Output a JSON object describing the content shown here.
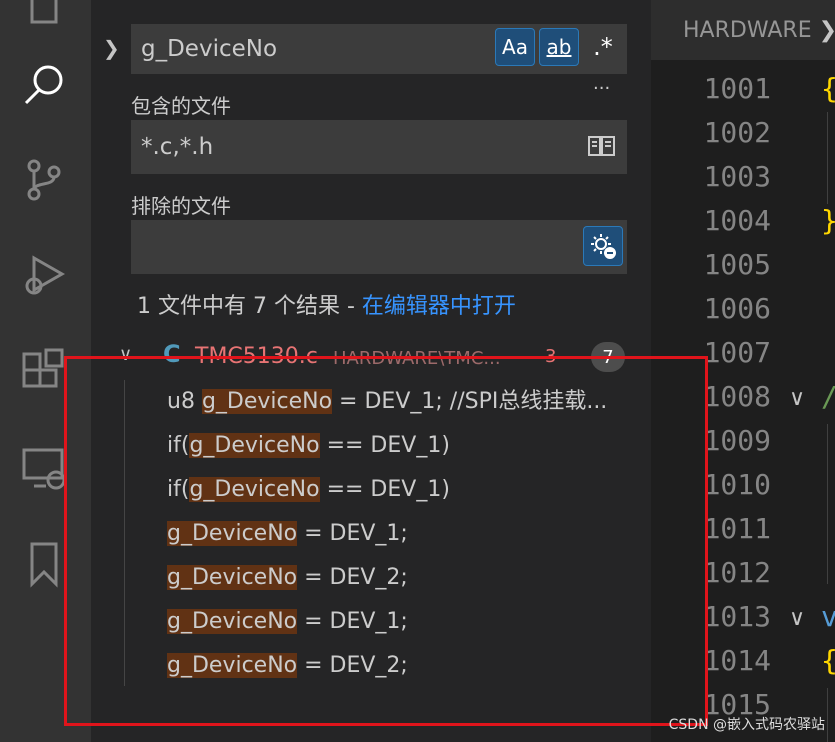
{
  "search": {
    "query": "g_DeviceNo",
    "match_case_label": "Aa",
    "match_word_label": "ab",
    "regex_label": ".*",
    "more_label": "···"
  },
  "include": {
    "label": "包含的文件",
    "value": "*.c,*.h"
  },
  "exclude": {
    "label": "排除的文件",
    "value": ""
  },
  "summary": {
    "text": "1 文件中有 7 个结果 - ",
    "link": "在编辑器中打开"
  },
  "file_result": {
    "icon_text": "C",
    "filename": "TMC5130.c",
    "path": "HARDWARE\\TMC...",
    "count_badge": "7",
    "problems": "3"
  },
  "results": [
    {
      "pre": "u8 ",
      "match": "g_DeviceNo",
      "post": " = DEV_1; //SPI总线挂载..."
    },
    {
      "pre": "if(",
      "match": "g_DeviceNo",
      "post": " == DEV_1)"
    },
    {
      "pre": "if(",
      "match": "g_DeviceNo",
      "post": " == DEV_1)"
    },
    {
      "pre": "",
      "match": "g_DeviceNo",
      "post": " = DEV_1;"
    },
    {
      "pre": "",
      "match": "g_DeviceNo",
      "post": " = DEV_2;"
    },
    {
      "pre": "",
      "match": "g_DeviceNo",
      "post": " = DEV_1;"
    },
    {
      "pre": "",
      "match": "g_DeviceNo",
      "post": " = DEV_2;"
    }
  ],
  "editor": {
    "tab_label": "HARDWARE",
    "line_numbers": [
      "1001",
      "1002",
      "1003",
      "1004",
      "1005",
      "1006",
      "1007",
      "1008",
      "1009",
      "1010",
      "1011",
      "1012",
      "1013",
      "1014",
      "1015"
    ],
    "code_glyphs": [
      {
        "text": "{",
        "color": "#ffd700"
      },
      {
        "text": "}",
        "color": "#ffd700"
      },
      {
        "text": "/",
        "color": "#6a9955"
      },
      {
        "text": "v",
        "color": "#569cd6"
      },
      {
        "text": "{",
        "color": "#ffd700"
      }
    ]
  },
  "watermark": "CSDN @嵌入式码农驿站",
  "colors": {
    "match_highlight": "#613214",
    "link": "#3794ff",
    "annotation_box": "#e0141b"
  }
}
